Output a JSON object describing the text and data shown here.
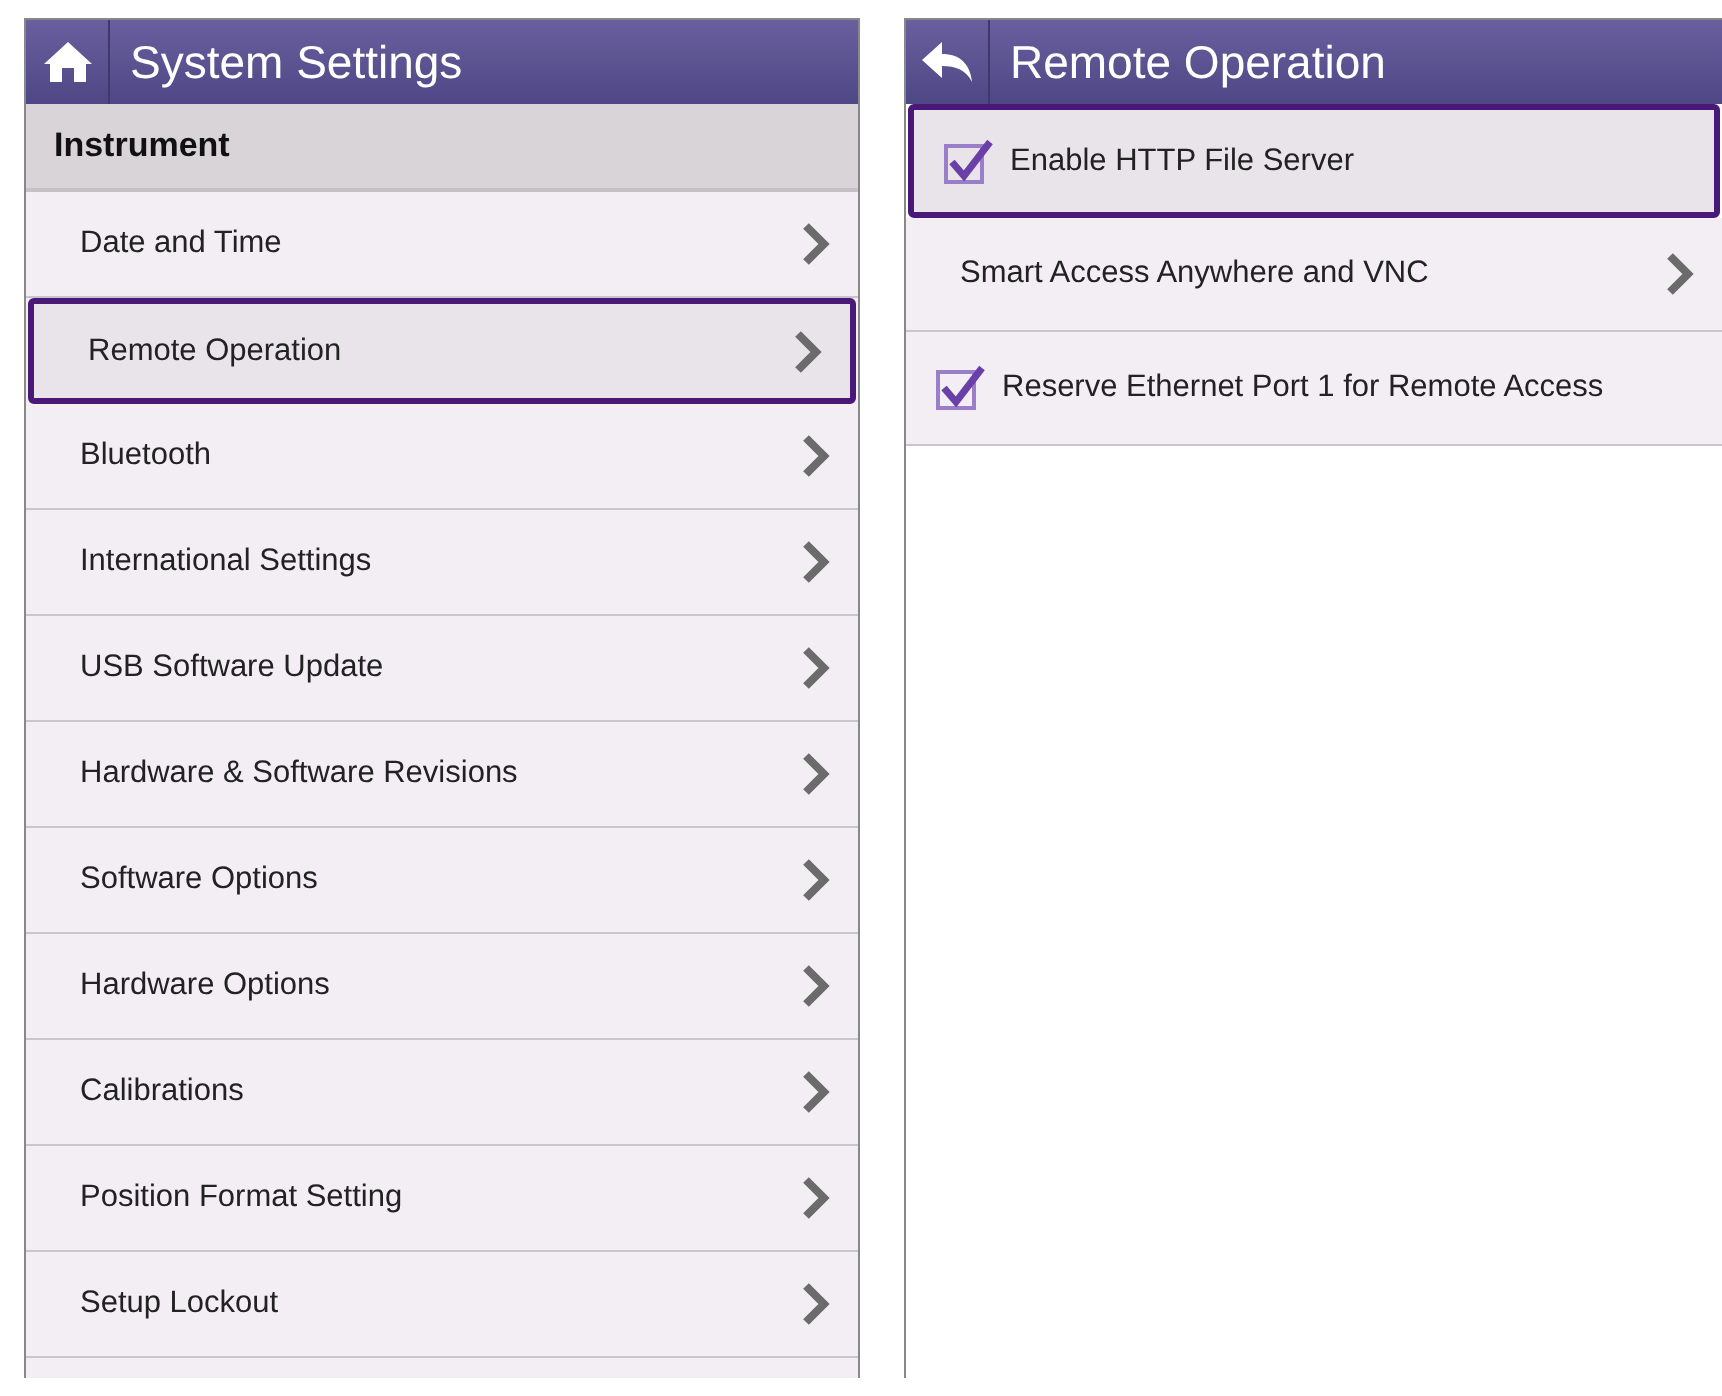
{
  "left_panel": {
    "title": "System Settings",
    "section": "Instrument",
    "items": [
      {
        "label": "Date and Time",
        "selected": false
      },
      {
        "label": "Remote Operation",
        "selected": true
      },
      {
        "label": "Bluetooth",
        "selected": false
      },
      {
        "label": "International Settings",
        "selected": false
      },
      {
        "label": "USB Software Update",
        "selected": false
      },
      {
        "label": "Hardware & Software Revisions",
        "selected": false
      },
      {
        "label": "Software Options",
        "selected": false
      },
      {
        "label": "Hardware Options",
        "selected": false
      },
      {
        "label": "Calibrations",
        "selected": false
      },
      {
        "label": "Position Format Setting",
        "selected": false
      },
      {
        "label": "Setup Lockout",
        "selected": false
      }
    ]
  },
  "right_panel": {
    "title": "Remote Operation",
    "items": [
      {
        "kind": "checkbox",
        "label": "Enable HTTP File Server",
        "checked": true,
        "selected": true
      },
      {
        "kind": "nav",
        "label": "Smart Access Anywhere and VNC",
        "selected": false
      },
      {
        "kind": "checkbox",
        "label": "Reserve Ethernet Port 1 for Remote Access",
        "checked": true,
        "selected": false
      }
    ]
  }
}
